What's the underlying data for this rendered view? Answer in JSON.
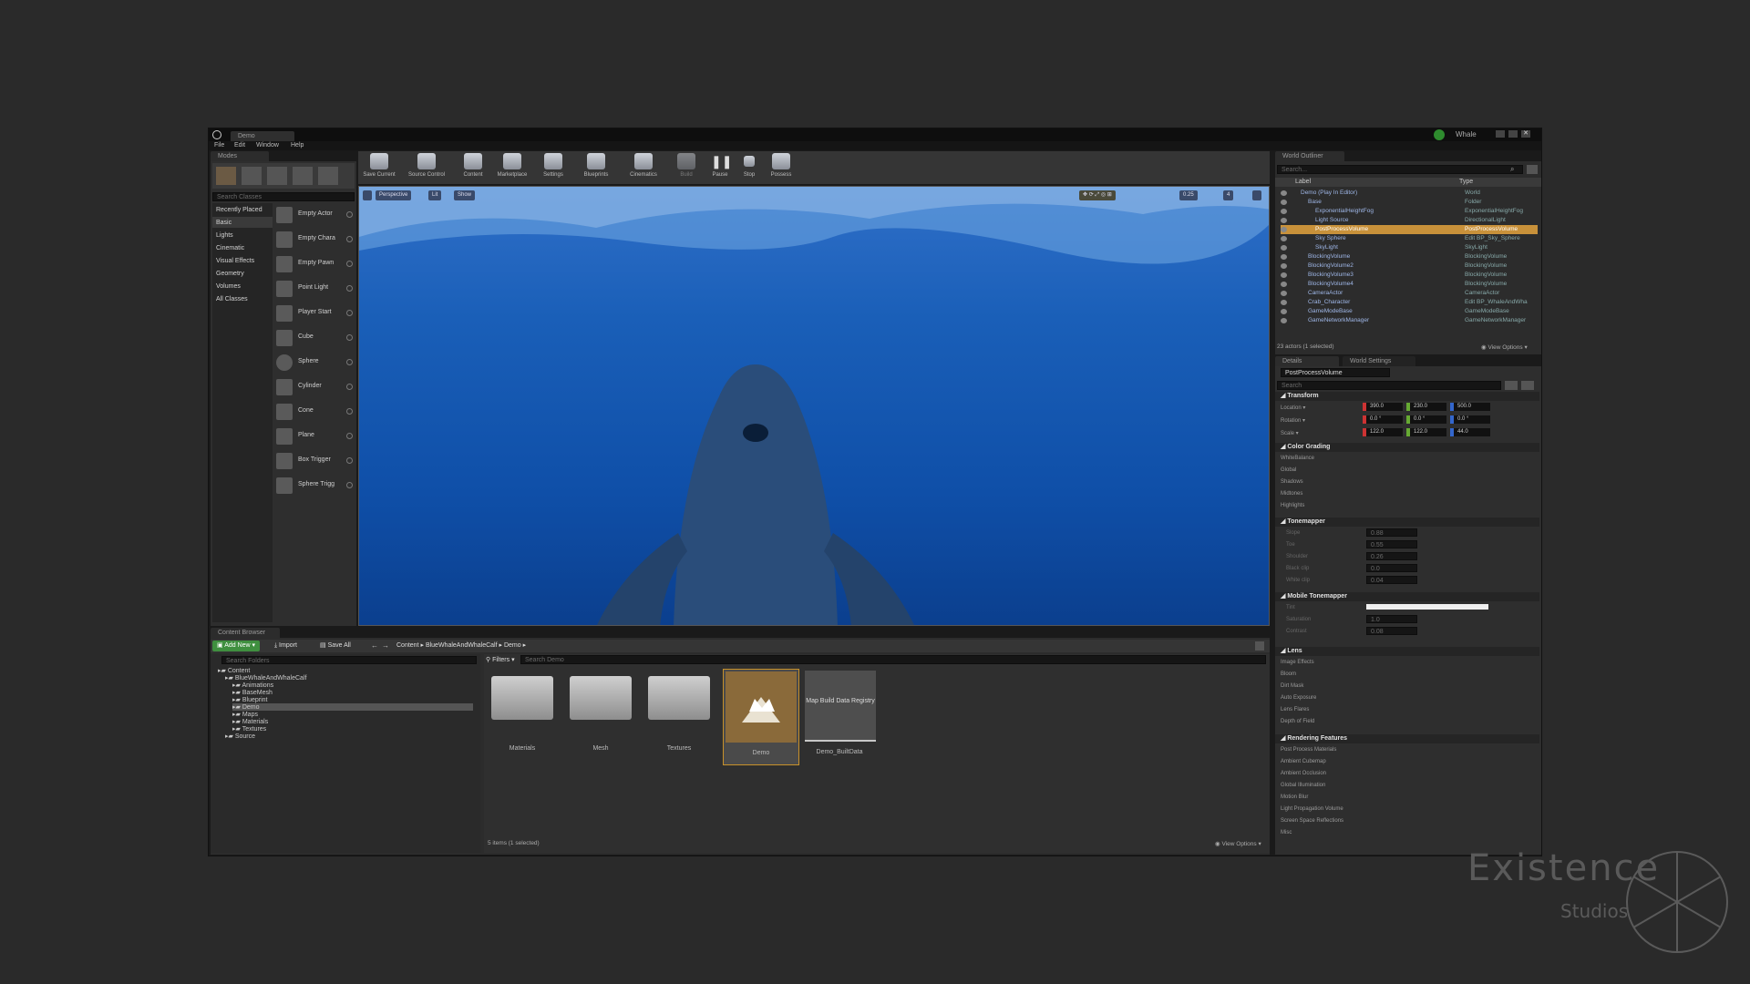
{
  "window": {
    "tab_title": "Demo",
    "project_name": "Whale",
    "menu": [
      "File",
      "Edit",
      "Window",
      "Help"
    ]
  },
  "modes": {
    "tab": "Modes",
    "search_placeholder": "Search Classes",
    "categories": [
      "Recently Placed",
      "Basic",
      "Lights",
      "Cinematic",
      "Visual Effects",
      "Geometry",
      "Volumes",
      "All Classes"
    ],
    "items": [
      "Empty Actor",
      "Empty Chara",
      "Empty Pawn",
      "Point Light",
      "Player Start",
      "Cube",
      "Sphere",
      "Cylinder",
      "Cone",
      "Plane",
      "Box Trigger",
      "Sphere Trigg"
    ]
  },
  "toolbar": {
    "buttons": [
      "Save Current",
      "Source Control",
      "Content",
      "Marketplace",
      "Settings",
      "Blueprints",
      "Cinematics",
      "Build",
      "Pause",
      "Stop",
      "Possess"
    ]
  },
  "viewport": {
    "perspective": "Perspective",
    "lit": "Lit",
    "show": "Show",
    "speed": "0.25",
    "cam": "4"
  },
  "outliner": {
    "tab": "World Outliner",
    "search_placeholder": "Search...",
    "col_label": "Label",
    "col_type": "Type",
    "rows": [
      {
        "label": "Demo (Play In Editor)",
        "type": "World",
        "indent": 0
      },
      {
        "label": "Base",
        "type": "Folder",
        "indent": 1
      },
      {
        "label": "ExponentialHeightFog",
        "type": "ExponentialHeightFog",
        "indent": 2
      },
      {
        "label": "Light Source",
        "type": "DirectionalLight",
        "indent": 2
      },
      {
        "label": "PostProcessVolume",
        "type": "PostProcessVolume",
        "indent": 2,
        "selected": true
      },
      {
        "label": "Sky Sphere",
        "type": "Edit BP_Sky_Sphere",
        "indent": 2
      },
      {
        "label": "SkyLight",
        "type": "SkyLight",
        "indent": 2
      },
      {
        "label": "BlockingVolume",
        "type": "BlockingVolume",
        "indent": 1
      },
      {
        "label": "BlockingVolume2",
        "type": "BlockingVolume",
        "indent": 1
      },
      {
        "label": "BlockingVolume3",
        "type": "BlockingVolume",
        "indent": 1
      },
      {
        "label": "BlockingVolume4",
        "type": "BlockingVolume",
        "indent": 1
      },
      {
        "label": "CameraActor",
        "type": "CameraActor",
        "indent": 1
      },
      {
        "label": "Crab_Character",
        "type": "Edit BP_WhaleAndWha",
        "indent": 1
      },
      {
        "label": "GameModeBase",
        "type": "GameModeBase",
        "indent": 1
      },
      {
        "label": "GameNetworkManager",
        "type": "GameNetworkManager",
        "indent": 1
      }
    ],
    "status": "23 actors (1 selected)",
    "view_options": "View Options"
  },
  "details": {
    "tab": "Details",
    "tab2": "World Settings",
    "actor_name": "PostProcessVolume",
    "search_placeholder": "Search",
    "transform": {
      "title": "Transform",
      "location_label": "Location",
      "rotation_label": "Rotation",
      "scale_label": "Scale",
      "location": [
        "390.0",
        "230.0",
        "500.0"
      ],
      "rotation": [
        "0.0 °",
        "0.0 °",
        "0.0 °"
      ],
      "scale": [
        "122.0",
        "122.0",
        "44.0"
      ]
    },
    "color_grading": {
      "title": "Color Grading",
      "props": [
        "WhiteBalance",
        "Global",
        "Shadows",
        "Midtones",
        "Highlights"
      ]
    },
    "tonemapper": {
      "title": "Tonemapper",
      "props": [
        {
          "label": "Slope",
          "value": "0.88"
        },
        {
          "label": "Toe",
          "value": "0.55"
        },
        {
          "label": "Shoulder",
          "value": "0.26"
        },
        {
          "label": "Black clip",
          "value": "0.0"
        },
        {
          "label": "White clip",
          "value": "0.04"
        }
      ]
    },
    "mobile_tonemapper": {
      "title": "Mobile Tonemapper",
      "props": [
        {
          "label": "Tint",
          "value": ""
        },
        {
          "label": "Saturation",
          "value": "1.0"
        },
        {
          "label": "Contrast",
          "value": "0.08"
        }
      ]
    },
    "lens": {
      "title": "Lens",
      "props": [
        "Image Effects",
        "Bloom",
        "Dirt Mask",
        "Auto Exposure",
        "Lens Flares",
        "Depth of Field"
      ]
    },
    "rendering": {
      "title": "Rendering Features",
      "props": [
        "Post Process Materials",
        "Ambient Cubemap",
        "Ambient Occlusion",
        "Global Illumination",
        "Motion Blur",
        "Light Propagation Volume",
        "Screen Space Reflections",
        "Misc"
      ]
    }
  },
  "content_browser": {
    "tab": "Content Browser",
    "add_new": "Add New",
    "import": "Import",
    "save_all": "Save All",
    "breadcrumb": [
      "Content",
      "BlueWhaleAndWhaleCalf",
      "Demo"
    ],
    "folder_search_placeholder": "Search Folders",
    "filters": "Filters",
    "asset_search_placeholder": "Search Demo",
    "tree": [
      {
        "label": "Content",
        "indent": 0
      },
      {
        "label": "BlueWhaleAndWhaleCalf",
        "indent": 1
      },
      {
        "label": "Animations",
        "indent": 2
      },
      {
        "label": "BaseMesh",
        "indent": 2
      },
      {
        "label": "Blueprint",
        "indent": 2
      },
      {
        "label": "Demo",
        "indent": 2,
        "selected": true
      },
      {
        "label": "Maps",
        "indent": 2
      },
      {
        "label": "Materials",
        "indent": 2
      },
      {
        "label": "Textures",
        "indent": 2
      },
      {
        "label": "Source",
        "indent": 1
      }
    ],
    "assets": [
      {
        "label": "Materials",
        "kind": "folder"
      },
      {
        "label": "Mesh",
        "kind": "folder"
      },
      {
        "label": "Textures",
        "kind": "folder"
      },
      {
        "label": "Demo",
        "kind": "level"
      },
      {
        "label": "Demo_BuiltData",
        "kind": "data",
        "thumb": "Map Build Data Registry"
      }
    ],
    "status": "5 items (1 selected)",
    "view_options": "View Options"
  },
  "watermark": {
    "title": "Existence",
    "subtitle": "Studios"
  }
}
